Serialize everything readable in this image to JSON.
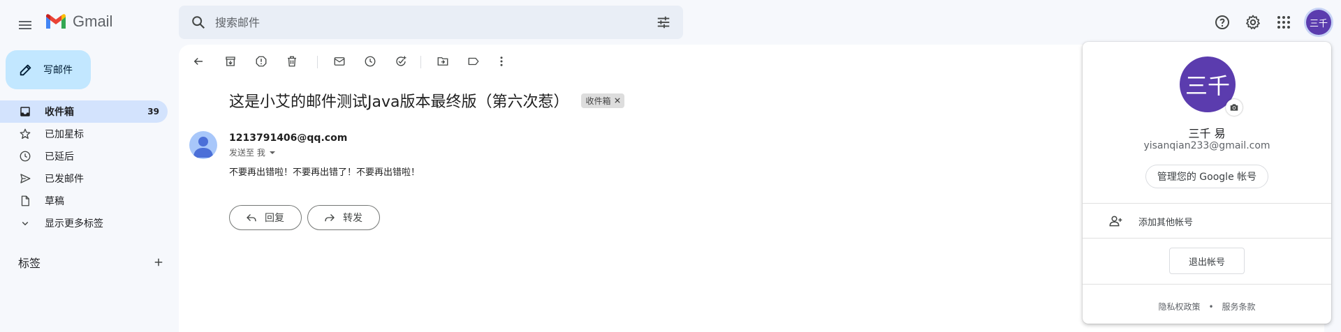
{
  "header": {
    "app_name": "Gmail",
    "search_placeholder": "搜索邮件",
    "account_initials": "三千"
  },
  "sidebar": {
    "compose_label": "写邮件",
    "items": [
      {
        "label": "收件箱",
        "count": "39",
        "icon": "inbox-icon",
        "active": true
      },
      {
        "label": "已加星标",
        "count": "",
        "icon": "star-icon"
      },
      {
        "label": "已延后",
        "count": "",
        "icon": "clock-icon"
      },
      {
        "label": "已发邮件",
        "count": "",
        "icon": "send-icon"
      },
      {
        "label": "草稿",
        "count": "",
        "icon": "draft-icon"
      },
      {
        "label": "显示更多标签",
        "count": "",
        "icon": "chevron-down-icon"
      }
    ],
    "labels_heading": "标签"
  },
  "message": {
    "subject": "这是小艾的邮件测试Java版本最终版（第六次惹）",
    "label_chip": "收件箱",
    "sender": "1213791406@qq.com",
    "recipient_line": "发送至 我",
    "body": "不要再出错啦！不要再出错了！不要再出错啦！",
    "reply_label": "回复",
    "forward_label": "转发"
  },
  "account_popup": {
    "initials": "三千",
    "name": "三千 易",
    "email": "yisanqian233@gmail.com",
    "manage_label": "管理您的 Google 帐号",
    "add_account_label": "添加其他帐号",
    "signout_label": "退出帐号",
    "privacy_label": "隐私权政策",
    "terms_label": "服务条款",
    "separator": "•"
  },
  "colors": {
    "accent_blue": "#c2e7ff",
    "active_nav": "#d3e3fd",
    "avatar_purple": "#5b3cae"
  }
}
